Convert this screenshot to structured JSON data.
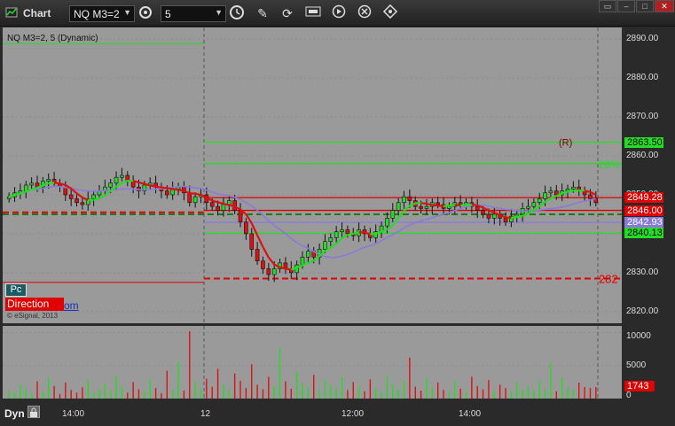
{
  "titlebar": {
    "app_title": "Chart",
    "symbol": "NQ M3=2",
    "interval": "5"
  },
  "chart_header": {
    "symbol_label": "NQ M3=2, 5 (Dynamic)",
    "copyright": "© eSignal, 2013"
  },
  "overlays": {
    "pc_label": "Pc",
    "direction_label": "Direction",
    "link_text": "om"
  },
  "price_axis": {
    "ticks": [
      "2890.00",
      "2880.00",
      "2870.00",
      "2860.00",
      "2850.00",
      "2840.00",
      "2830.00",
      "2820.00"
    ],
    "flags": [
      {
        "label": "2863.50",
        "bg": "#22dd22",
        "fg": "#000000"
      },
      {
        "label": "2849.28",
        "bg": "#e00000",
        "fg": "#ffffff"
      },
      {
        "label": "2846.00",
        "bg": "#e00000",
        "fg": "#ffffff"
      },
      {
        "label": "2842.93",
        "bg": "#8a7ad8",
        "fg": "#ffffff"
      },
      {
        "label": "2840.13",
        "bg": "#22dd22",
        "fg": "#000000"
      }
    ]
  },
  "annotations": {
    "r_label": "(R)",
    "pct_label": "28%",
    "level_label": "282"
  },
  "volume_axis": {
    "ticks": [
      "10000",
      "5000",
      "0"
    ],
    "flag": "1743"
  },
  "time_axis": {
    "pane_label": "Dyn",
    "ticks": [
      "14:00",
      "12",
      "12:00",
      "14:00"
    ]
  },
  "colors": {
    "chart_bg": "#9a9a9a",
    "up_bar": "#22dd22",
    "down_bar": "#dd1111",
    "ma_purple": "#8a7ad8",
    "count_green": "#1d7a1d",
    "count_magenta": "#d020d0"
  },
  "chart_data": {
    "type": "candlestick",
    "title": "NQ M3=2, 5 (Dynamic)",
    "ylim": [
      2817,
      2893
    ],
    "price_ticks": [
      2890,
      2880,
      2870,
      2860,
      2850,
      2840,
      2830,
      2820
    ],
    "levels": [
      {
        "price": 2863.5,
        "color": "#22dd22",
        "style": "solid"
      },
      {
        "price": 2858.0,
        "color": "#22dd22",
        "style": "solid"
      },
      {
        "price": 2849.28,
        "color": "#e00000",
        "style": "solid"
      },
      {
        "price": 2846.0,
        "color": "#e00000",
        "style": "solid"
      },
      {
        "price": 2845.0,
        "color": "#1d7a1d",
        "style": "dashed"
      },
      {
        "price": 2842.93,
        "color": "#8a7ad8",
        "style": "solid"
      },
      {
        "price": 2840.13,
        "color": "#22dd22",
        "style": "solid"
      },
      {
        "price": 2828.5,
        "color": "#e00000",
        "style": "dashed"
      }
    ],
    "close": [
      2849.5,
      2850.5,
      2851.0,
      2852.5,
      2853.0,
      2852.0,
      2853.5,
      2854.0,
      2853.0,
      2852.0,
      2850.0,
      2849.0,
      2848.0,
      2847.5,
      2849.0,
      2850.0,
      2851.0,
      2852.0,
      2853.0,
      2854.5,
      2855.0,
      2853.5,
      2852.0,
      2851.0,
      2852.5,
      2853.0,
      2852.0,
      2851.0,
      2850.0,
      2851.5,
      2852.0,
      2850.5,
      2848.0,
      2849.5,
      2850.0,
      2848.0,
      2847.0,
      2846.0,
      2847.5,
      2848.5,
      2846.0,
      2843.0,
      2840.0,
      2836.0,
      2833.0,
      2831.0,
      2829.5,
      2831.0,
      2832.5,
      2831.0,
      2830.0,
      2832.0,
      2834.0,
      2835.5,
      2834.0,
      2836.0,
      2838.0,
      2839.0,
      2840.5,
      2841.0,
      2840.0,
      2839.5,
      2841.0,
      2840.0,
      2839.0,
      2840.5,
      2842.0,
      2844.0,
      2846.0,
      2848.0,
      2849.5,
      2848.5,
      2847.0,
      2846.5,
      2847.0,
      2848.0,
      2847.5,
      2846.5,
      2847.0,
      2848.0,
      2847.5,
      2848.0,
      2847.0,
      2846.0,
      2845.0,
      2844.0,
      2845.0,
      2844.0,
      2843.0,
      2844.5,
      2845.0,
      2846.5,
      2847.0,
      2848.0,
      2849.0,
      2850.5,
      2851.0,
      2850.0,
      2851.0,
      2851.5,
      2852.0,
      2851.0,
      2850.0,
      2849.0,
      2848.0
    ],
    "volume": [
      1200,
      900,
      2100,
      1500,
      800,
      2600,
      1100,
      3200,
      1900,
      700,
      2400,
      1300,
      900,
      1700,
      2800,
      1000,
      1500,
      2200,
      1200,
      3400,
      1800,
      900,
      2500,
      1400,
      1100,
      2900,
      1600,
      800,
      4200,
      1300,
      5600,
      1200,
      10200,
      2500,
      1500,
      3000,
      1800,
      4500,
      2200,
      1300,
      3800,
      2700,
      1600,
      5200,
      2100,
      1400,
      3300,
      1900,
      7600,
      2600,
      1500,
      4100,
      2300,
      1700,
      3600,
      1200,
      2800,
      2000,
      1500,
      3200,
      1300,
      2500,
      1800,
      1100,
      2900,
      1600,
      1000,
      3500,
      2200,
      1400,
      2700,
      6200,
      1800,
      1200,
      3100,
      1700,
      2400,
      1300,
      900,
      2600,
      1500,
      1100,
      3300,
      1900,
      1400,
      2800,
      1200,
      2100,
      1600,
      1000,
      2500,
      1400,
      1900,
      1200,
      2700,
      1500,
      5400,
      1100,
      3200,
      1700,
      1300,
      2400,
      1743,
      1600,
      1743
    ]
  }
}
